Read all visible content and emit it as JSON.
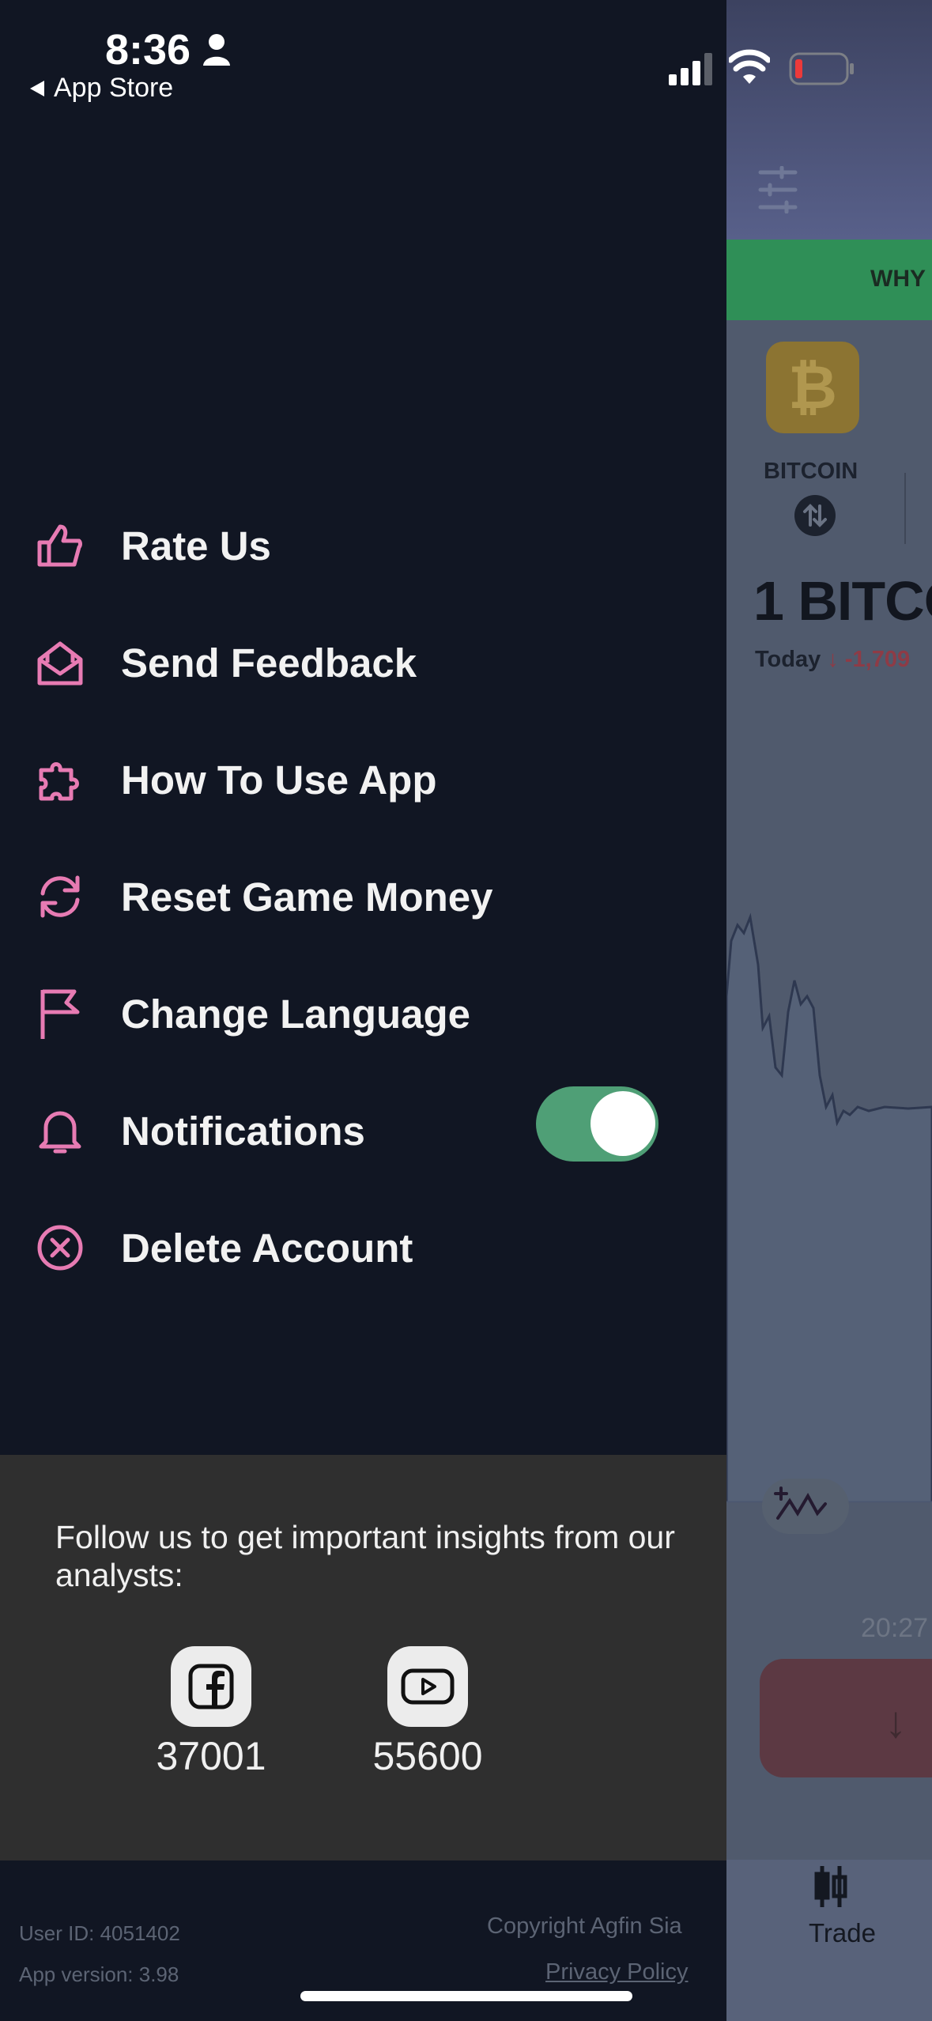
{
  "status_bar": {
    "time": "8:36",
    "back_label": "App Store"
  },
  "menu": {
    "items": [
      {
        "label": "Rate Us",
        "icon": "thumbs-up-icon"
      },
      {
        "label": "Send Feedback",
        "icon": "mail-open-icon"
      },
      {
        "label": "How To Use App",
        "icon": "puzzle-icon"
      },
      {
        "label": "Reset Game Money",
        "icon": "refresh-icon"
      },
      {
        "label": "Change Language",
        "icon": "flag-icon"
      },
      {
        "label": "Notifications",
        "icon": "bell-icon"
      },
      {
        "label": "Delete Account",
        "icon": "x-circle-icon"
      }
    ],
    "notifications_enabled": true
  },
  "follow": {
    "text": "Follow us to get important insights from our analysts:",
    "socials": [
      {
        "name": "facebook-icon",
        "count": "37001"
      },
      {
        "name": "youtube-icon",
        "count": "55600"
      }
    ]
  },
  "footer": {
    "user_id": "User ID: 4051402",
    "app_version": "App version: 3.98",
    "copyright": "Copyright Agfin Sia",
    "privacy": "Privacy Policy"
  },
  "background_app": {
    "banner_text": "WHY",
    "coin_label": "BITCOIN",
    "price_title": "1 BITCO",
    "today_label": "Today",
    "today_change": "↓ -1,709",
    "chart_time": "20:27",
    "trade_label": "Trade"
  },
  "colors": {
    "accent_pink": "#e77bb3",
    "toggle_on": "#4f9f76",
    "drawer_bg": "#111623",
    "follow_bg": "#2f2f2f"
  }
}
